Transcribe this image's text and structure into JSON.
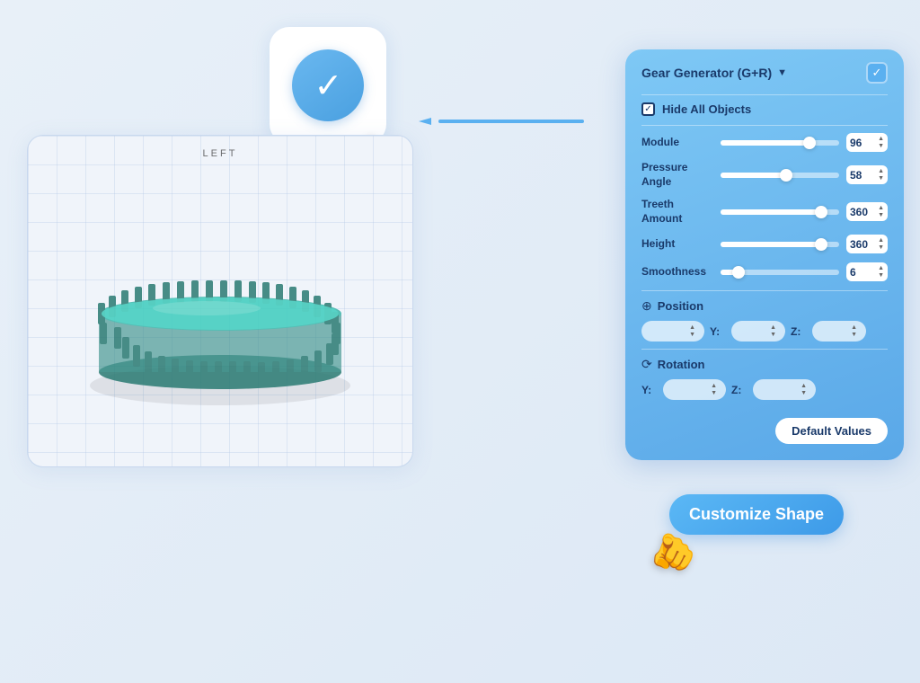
{
  "app": {
    "background": "#dce8f5"
  },
  "confirm_card": {
    "label": "Confirm"
  },
  "viewport": {
    "label": "LEFT"
  },
  "panel": {
    "title": "Gear Generator (G+R)",
    "hide_all_label": "Hide All Objects",
    "sliders": [
      {
        "label": "Module",
        "value": "96",
        "fill_pct": 75
      },
      {
        "label": "Pressure\nAngle",
        "value": "58",
        "fill_pct": 55
      },
      {
        "label": "Treeth\nAmount",
        "value": "360",
        "fill_pct": 85
      },
      {
        "label": "Height",
        "value": "360",
        "fill_pct": 85
      },
      {
        "label": "Smoothness",
        "value": "6",
        "fill_pct": 15
      }
    ],
    "position_section": {
      "label": "Position",
      "y_label": "Y:",
      "z_label": "Z:"
    },
    "rotation_section": {
      "label": "Rotation",
      "y_label": "Y:",
      "z_label": "Z:"
    },
    "default_values_btn": "Default Values"
  },
  "customize_shape": {
    "label": "Customize Shape"
  }
}
